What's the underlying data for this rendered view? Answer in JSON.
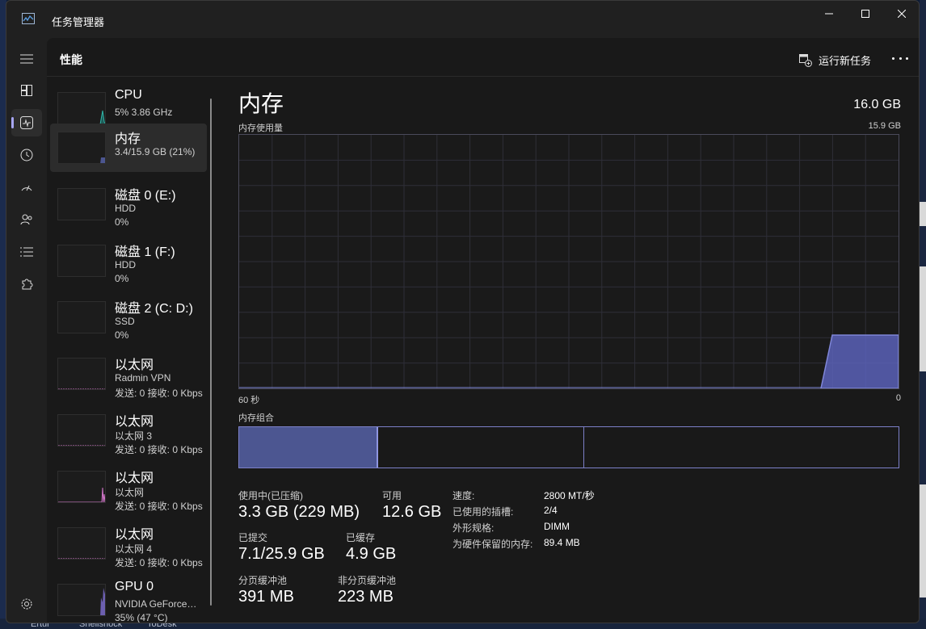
{
  "window": {
    "title": "任务管理器"
  },
  "header": {
    "page_title": "性能",
    "run_task_label": "运行新任务"
  },
  "devices": [
    {
      "name": "CPU",
      "line1": "5% 3.86 GHz",
      "line2": "",
      "graph_color": "#2fb5a8"
    },
    {
      "name": "内存",
      "line1": "3.4/15.9 GB (21%)",
      "line2": "",
      "graph_color": "#7f86d8"
    },
    {
      "name": "磁盘 0 (E:)",
      "line1": "HDD",
      "line2": "0%",
      "graph_color": "#3fa873"
    },
    {
      "name": "磁盘 1 (F:)",
      "line1": "HDD",
      "line2": "0%",
      "graph_color": "#3fa873"
    },
    {
      "name": "磁盘 2 (C: D:)",
      "line1": "SSD",
      "line2": "0%",
      "graph_color": "#3fa873"
    },
    {
      "name": "以太网",
      "line1": "Radmin VPN",
      "line2": "发送: 0 接收: 0 Kbps",
      "graph_color": "#d276c9"
    },
    {
      "name": "以太网",
      "line1": "以太网 3",
      "line2": "发送: 0 接收: 0 Kbps",
      "graph_color": "#d276c9"
    },
    {
      "name": "以太网",
      "line1": "以太网",
      "line2": "发送: 0 接收: 0 Kbps",
      "graph_color": "#d276c9"
    },
    {
      "name": "以太网",
      "line1": "以太网 4",
      "line2": "发送: 0 接收: 0 Kbps",
      "graph_color": "#d276c9"
    },
    {
      "name": "GPU 0",
      "line1": "NVIDIA GeForce…",
      "line2": "35% (47 °C)",
      "graph_color": "#9b8ef0"
    }
  ],
  "detail": {
    "title": "内存",
    "total": "16.0 GB",
    "usage_label": "内存使用量",
    "usage_max": "15.9 GB",
    "axis_left": "60 秒",
    "axis_right": "0",
    "composition_label": "内存组合",
    "accent": "#7f86d8",
    "stats": {
      "in_use_label": "使用中(已压缩)",
      "in_use_value": "3.3 GB (229 MB)",
      "available_label": "可用",
      "available_value": "12.6 GB",
      "committed_label": "已提交",
      "committed_value": "7.1/25.9 GB",
      "cached_label": "已缓存",
      "cached_value": "4.9 GB",
      "paged_label": "分页缓冲池",
      "paged_value": "391 MB",
      "nonpaged_label": "非分页缓冲池",
      "nonpaged_value": "223 MB"
    },
    "specs": [
      {
        "key": "速度:",
        "value": "2800 MT/秒"
      },
      {
        "key": "已使用的插槽:",
        "value": "2/4"
      },
      {
        "key": "外形规格:",
        "value": "DIMM"
      },
      {
        "key": "为硬件保留的内存:",
        "value": "89.4 MB"
      }
    ]
  },
  "taskbar": {
    "items": [
      "Ertui",
      "Shellshock",
      "ToDesk"
    ]
  }
}
